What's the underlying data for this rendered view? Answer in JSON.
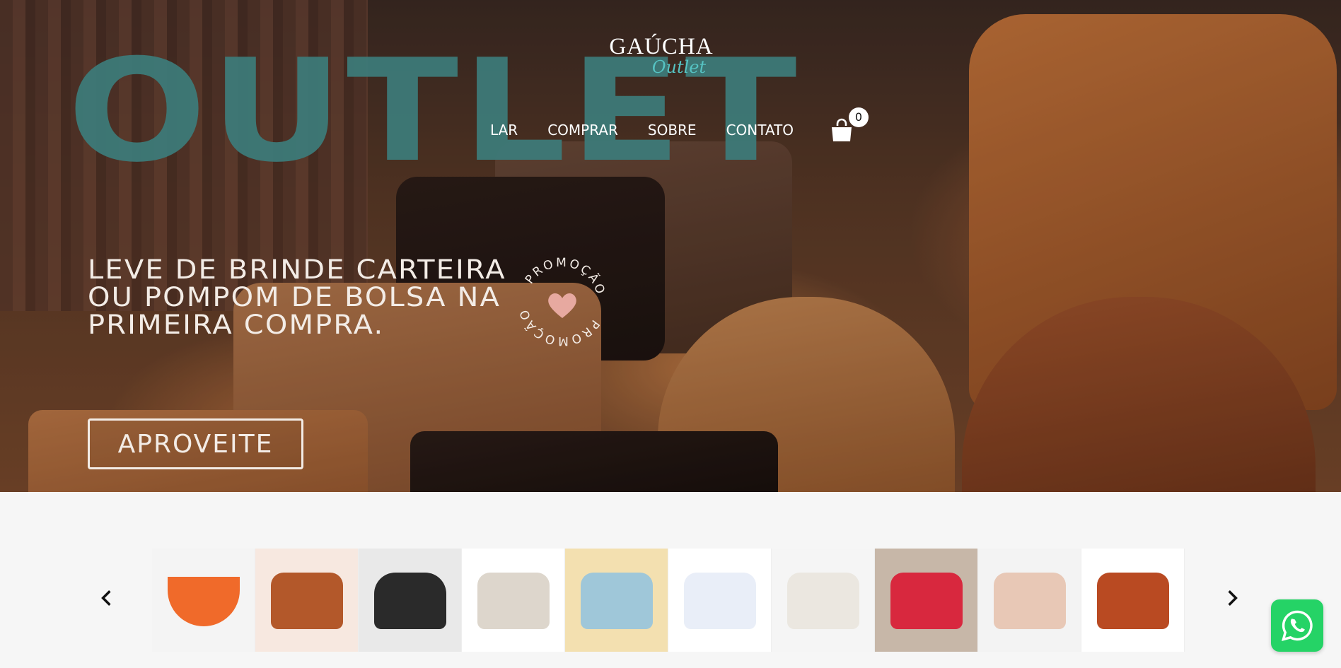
{
  "brand": {
    "name": "GAÚCHA",
    "sub": "Outlet"
  },
  "hero": {
    "big_word": "OUTLET",
    "promo": "LEVE DE BRINDE CARTEIRA OU POMPOM DE BOLSA NA PRIMEIRA COMPRA.",
    "badge_text": "PROMOÇÃO",
    "cta": "APROVEITE"
  },
  "nav": {
    "items": [
      "LAR",
      "COMPRAR",
      "SOBRE",
      "CONTATO"
    ]
  },
  "cart": {
    "count": "0"
  },
  "carousel": {
    "products": [
      {
        "color": "#f06a2a",
        "bg": "#f4f4f4"
      },
      {
        "color": "#b3582a",
        "bg": "#f7e8e0"
      },
      {
        "color": "#2a2a2a",
        "bg": "#e9e9e9"
      },
      {
        "color": "#ddd6cc",
        "bg": "#ffffff"
      },
      {
        "color": "#9fc7d9",
        "bg": "#f3e0b0"
      },
      {
        "color": "#e9eef8",
        "bg": "#ffffff"
      },
      {
        "color": "#ebe7e0",
        "bg": "#f5f5f5"
      },
      {
        "color": "#d8283e",
        "bg": "#c7b7a8"
      },
      {
        "color": "#e8c8b6",
        "bg": "#f3f3f3"
      },
      {
        "color": "#b94a22",
        "bg": "#ffffff"
      }
    ]
  },
  "icons": {
    "prev": "chevron-left-icon",
    "next": "chevron-right-icon",
    "cart": "shopping-bag-icon",
    "chat": "whatsapp-icon"
  }
}
